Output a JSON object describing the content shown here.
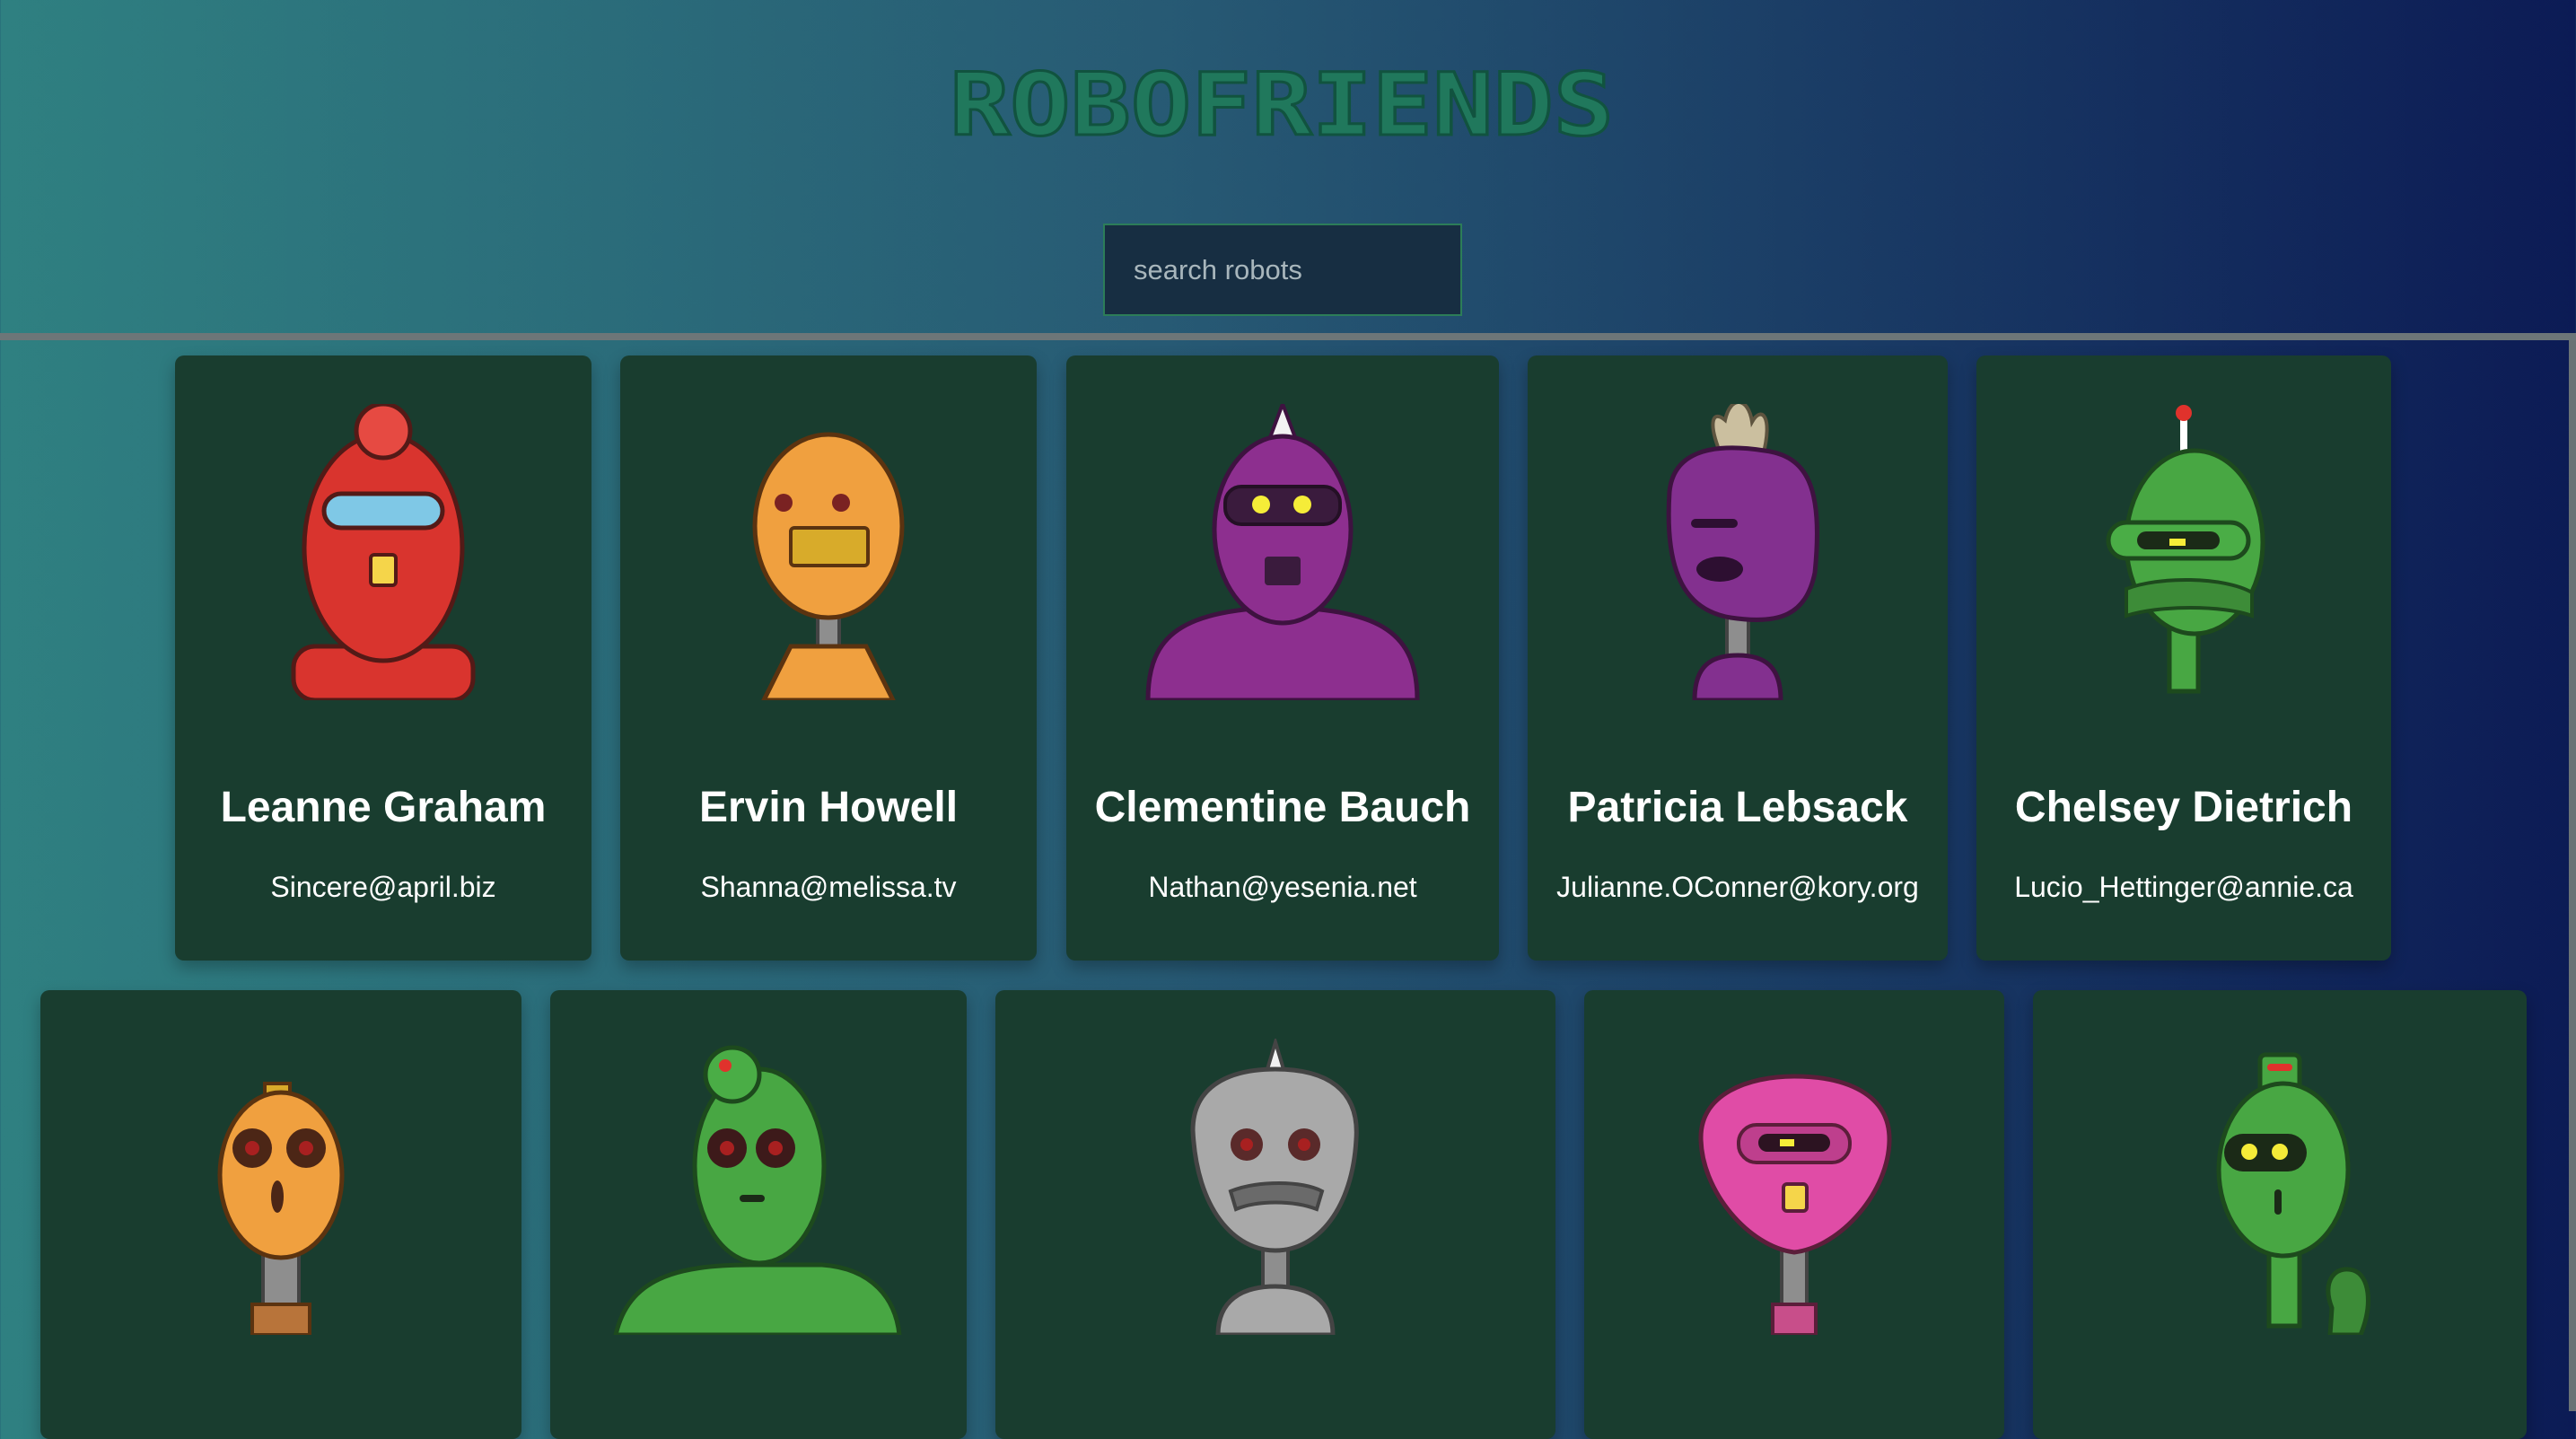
{
  "app": {
    "title": "ROBOFRIENDS"
  },
  "search": {
    "placeholder": "search robots",
    "value": ""
  },
  "robots": [
    {
      "name": "Leanne Graham",
      "email": "Sincere@april.biz",
      "color": "#d9342e"
    },
    {
      "name": "Ervin Howell",
      "email": "Shanna@melissa.tv",
      "color": "#f0a03f"
    },
    {
      "name": "Clementine Bauch",
      "email": "Nathan@yesenia.net",
      "color": "#8d2f8f"
    },
    {
      "name": "Patricia Lebsack",
      "email": "Julianne.OConner@kory.org",
      "color": "#83308f"
    },
    {
      "name": "Chelsey Dietrich",
      "email": "Lucio_Hettinger@annie.ca",
      "color": "#48a743"
    },
    {
      "name": "",
      "email": "",
      "color": "#f0a03f"
    },
    {
      "name": "",
      "email": "",
      "color": "#48a743"
    },
    {
      "name": "",
      "email": "",
      "color": "#a9a9a9"
    },
    {
      "name": "",
      "email": "",
      "color": "#e04ca6"
    },
    {
      "name": "",
      "email": "",
      "color": "#48a743"
    }
  ]
}
